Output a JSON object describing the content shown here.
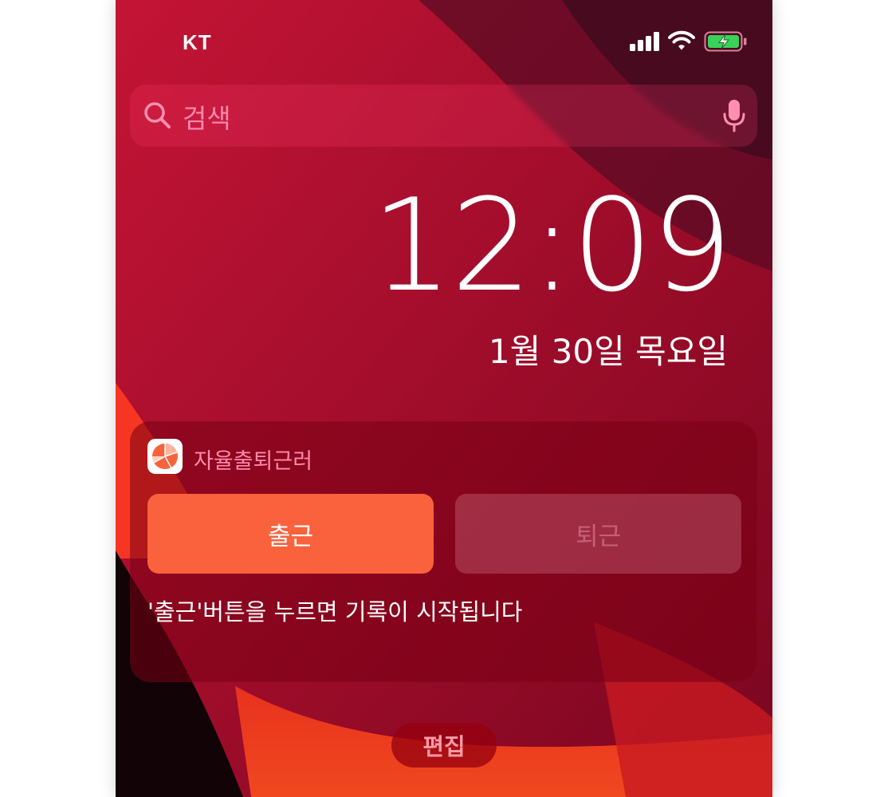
{
  "status_bar": {
    "carrier": "KT",
    "icons": [
      "signal-icon",
      "wifi-icon",
      "battery-charging-icon"
    ]
  },
  "search": {
    "placeholder": "검색",
    "icons": [
      "search-icon",
      "microphone-icon"
    ]
  },
  "lockscreen": {
    "time": "12:09",
    "date": "1월 30일 목요일"
  },
  "widget": {
    "app_name": "자율출퇴근러",
    "check_in_label": "출근",
    "check_out_label": "퇴근",
    "hint": "'출근'버튼을 누르면 기록이 시작됩니다"
  },
  "edit_label": "편집",
  "colors": {
    "accent": "#f9623c",
    "battery": "#3ad15a",
    "wallpaper": "#a10a2a"
  }
}
